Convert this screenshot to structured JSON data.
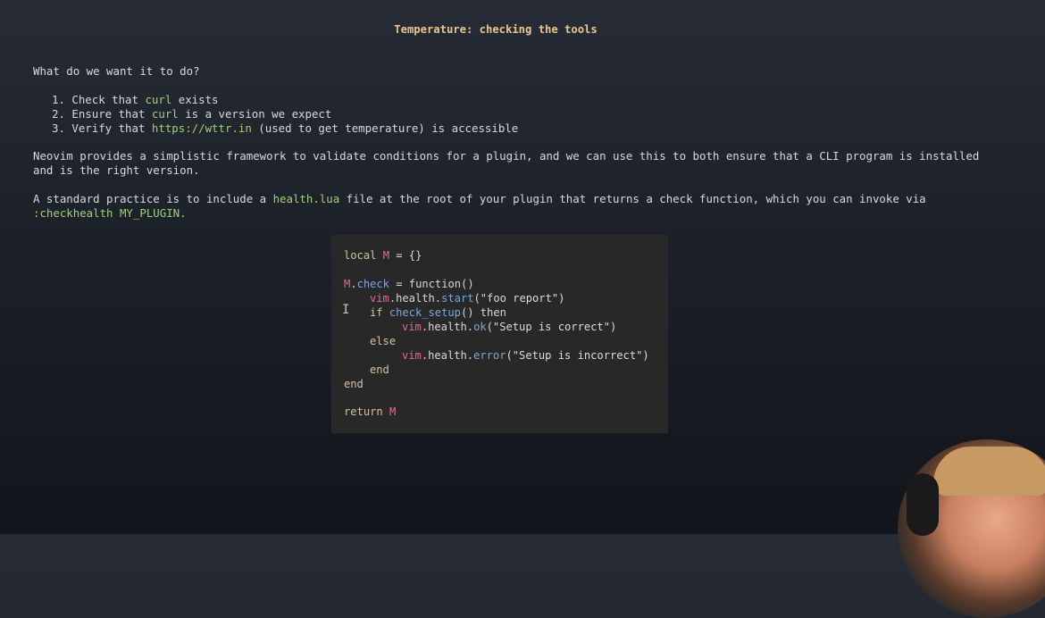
{
  "title": "Temperature: checking the tools",
  "intro": "What do we want it to do?",
  "steps": [
    {
      "pre": "1. Check that ",
      "code": "curl",
      "post": " exists"
    },
    {
      "pre": "2. Ensure that ",
      "code": "curl",
      "post": " is a version we expect"
    },
    {
      "pre": "3. Verify that ",
      "code": "https://wttr.in",
      "post": " (used to get temperature) is accessible"
    }
  ],
  "para1_line1": "Neovim provides a simplistic framework to validate conditions for a plugin, and we can use this to both ensure that a CLI program is installed",
  "para1_line2": "and is the right version.",
  "para2": {
    "pre": "A standard practice is to include a ",
    "code": "health.lua",
    "post": " file at the root of your plugin that returns a check function, which you can invoke via",
    "line2": ":checkhealth MY_PLUGIN."
  },
  "code": {
    "l1_kw": "local",
    "l1_var": "M",
    "l1_rest": " = {}",
    "l2_var": "M",
    "l2_fn": "check",
    "l2_rest": " = function()",
    "l3_vim": "vim",
    "l3_mid": ".health.",
    "l3_fn": "start",
    "l3_str": "(\"foo report\")",
    "l4_kw": "if",
    "l4_fn": "check_setup",
    "l4_rest": "() then",
    "l5_vim": "vim",
    "l5_mid": ".health.",
    "l5_fn": "ok",
    "l5_str": "(\"Setup is correct\")",
    "l6": "else",
    "l7_vim": "vim",
    "l7_mid": ".health.",
    "l7_fn": "error",
    "l7_str": "(\"Setup is incorrect\")",
    "l8": "end",
    "l9": "end",
    "l10_kw": "return",
    "l10_var": "M"
  }
}
